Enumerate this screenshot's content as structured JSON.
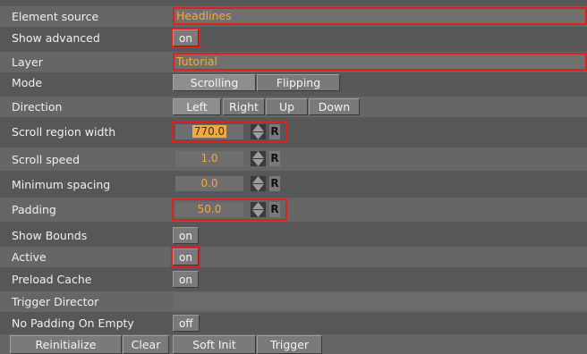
{
  "rows": {
    "element_source": {
      "label": "Element source",
      "value": "Headlines"
    },
    "show_advanced": {
      "label": "Show advanced",
      "value": "on"
    },
    "layer": {
      "label": "Layer",
      "value": "Tutorial"
    },
    "mode": {
      "label": "Mode",
      "options": [
        "Scrolling",
        "Flipping"
      ]
    },
    "direction": {
      "label": "Direction",
      "options": [
        "Left",
        "Right",
        "Up",
        "Down"
      ]
    },
    "scroll_region_width": {
      "label": "Scroll region width",
      "value": "770.0",
      "reset": "R"
    },
    "scroll_speed": {
      "label": "Scroll speed",
      "value": "1.0",
      "reset": "R"
    },
    "minimum_spacing": {
      "label": "Minimum spacing",
      "value": "0.0",
      "reset": "R"
    },
    "padding": {
      "label": "Padding",
      "value": "50.0",
      "reset": "R"
    },
    "show_bounds": {
      "label": "Show Bounds",
      "value": "on"
    },
    "active": {
      "label": "Active",
      "value": "on"
    },
    "preload_cache": {
      "label": "Preload Cache",
      "value": "on"
    },
    "trigger_director": {
      "label": "Trigger Director",
      "value": ""
    },
    "no_padding_on_empty": {
      "label": "No Padding On Empty",
      "value": "off"
    }
  },
  "buttons": [
    "Reinitialize",
    "Clear",
    "Soft Init",
    "Trigger"
  ],
  "colors": {
    "highlight": "#e02020",
    "value_text": "#f3a93b"
  }
}
